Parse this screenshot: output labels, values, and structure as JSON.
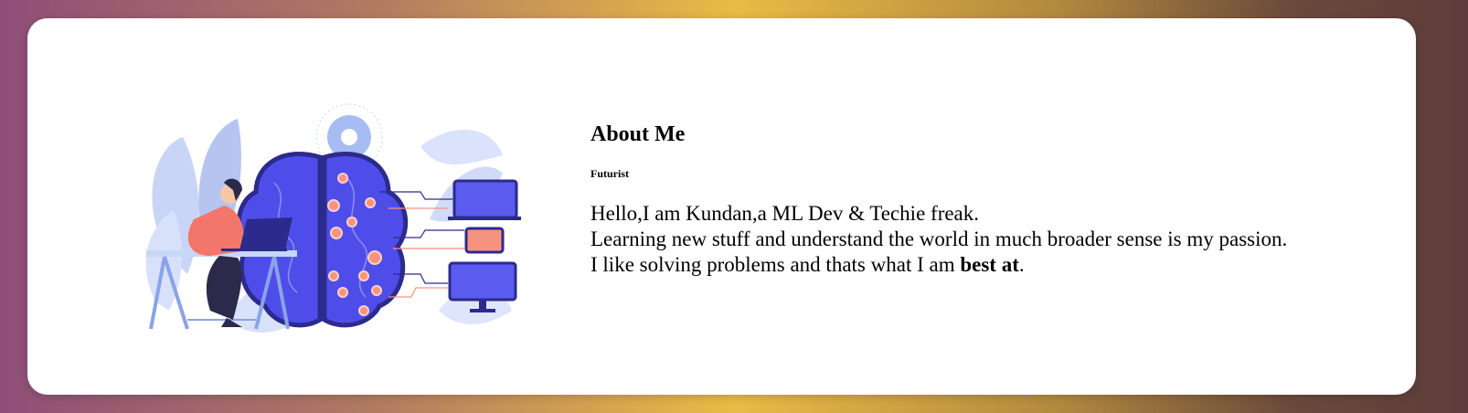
{
  "about": {
    "title": "About Me",
    "subtitle": "Futurist",
    "line1": "Hello,I am Kundan,a ML Dev & Techie freak.",
    "line2": "Learning new stuff and understand the world in much broader sense is my passion.",
    "line3_prefix": "I like solving problems and thats what I am ",
    "line3_bold": "best at",
    "line3_suffix": "."
  },
  "illustration": {
    "icon": "developer-brain-illustration",
    "colors": {
      "brain": "#4f4dea",
      "brain_dark": "#2c2a8c",
      "node": "#f6937f",
      "leaf": "#b9c9f5",
      "person_shirt": "#f2776a",
      "device_screen": "#5b5bf0"
    }
  },
  "background": {
    "gradient": [
      "#8e4e78",
      "#e8bb45",
      "#5e3c3c"
    ]
  }
}
